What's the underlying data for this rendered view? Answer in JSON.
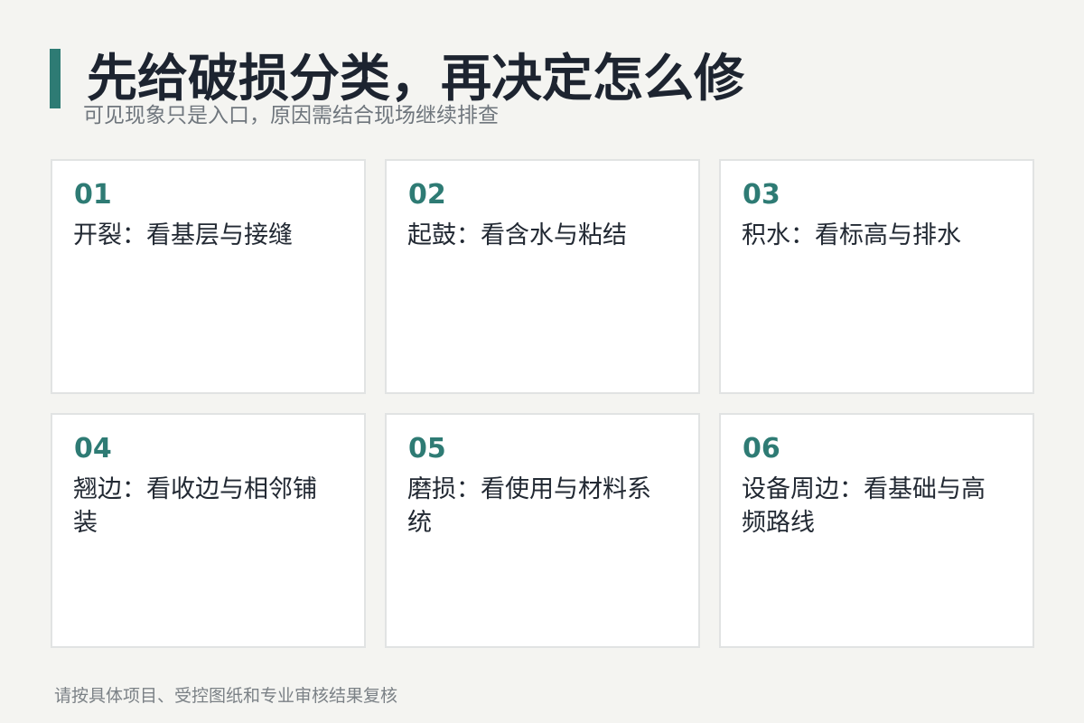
{
  "header": {
    "title": "先给破损分类，再决定怎么修",
    "subtitle": "可见现象只是入口，原因需结合现场继续排查"
  },
  "cards": [
    {
      "number": "01",
      "text": "开裂：看基层与接缝"
    },
    {
      "number": "02",
      "text": "起鼓：看含水与粘结"
    },
    {
      "number": "03",
      "text": "积水：看标高与排水"
    },
    {
      "number": "04",
      "text": "翘边：看收边与相邻铺装"
    },
    {
      "number": "05",
      "text": "磨损：看使用与材料系统"
    },
    {
      "number": "06",
      "text": "设备周边：看基础与高频路线"
    }
  ],
  "footer": {
    "note": "请按具体项目、受控图纸和专业审核结果复核"
  },
  "colors": {
    "accent": "#2e7b74",
    "background": "#f4f4f1",
    "card": "#ffffff",
    "title": "#1d2430",
    "muted_text": "#6f767d"
  }
}
